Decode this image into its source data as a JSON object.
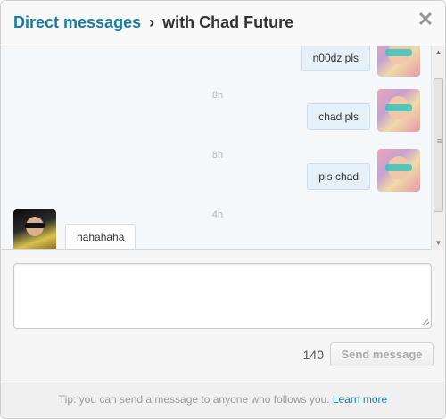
{
  "header": {
    "title_link": "Direct messages",
    "separator": "›",
    "conversation_title": "with Chad Future",
    "close_glyph": "✕"
  },
  "messages": [
    {
      "text": "n00dz pls",
      "direction": "sent",
      "avatar": "user-photo-sent"
    },
    {
      "timestamp": "8h"
    },
    {
      "text": "chad pls",
      "direction": "sent",
      "avatar": "user-photo-sent"
    },
    {
      "timestamp": "8h"
    },
    {
      "text": "pls chad",
      "direction": "sent",
      "avatar": "user-photo-sent"
    },
    {
      "timestamp": "4h"
    },
    {
      "text": "hahahaha",
      "direction": "received",
      "avatar": "chad-future-photo"
    }
  ],
  "composer": {
    "value": "",
    "placeholder": "",
    "char_count": "140",
    "send_label": "Send message"
  },
  "footer": {
    "tip": "Tip: you can send a message to anyone who follows you.",
    "learn_more": "Learn more"
  },
  "colors": {
    "link": "#1a7ba6",
    "sent_bubble": "#e6f0f8",
    "received_bubble": "#ffffff"
  }
}
